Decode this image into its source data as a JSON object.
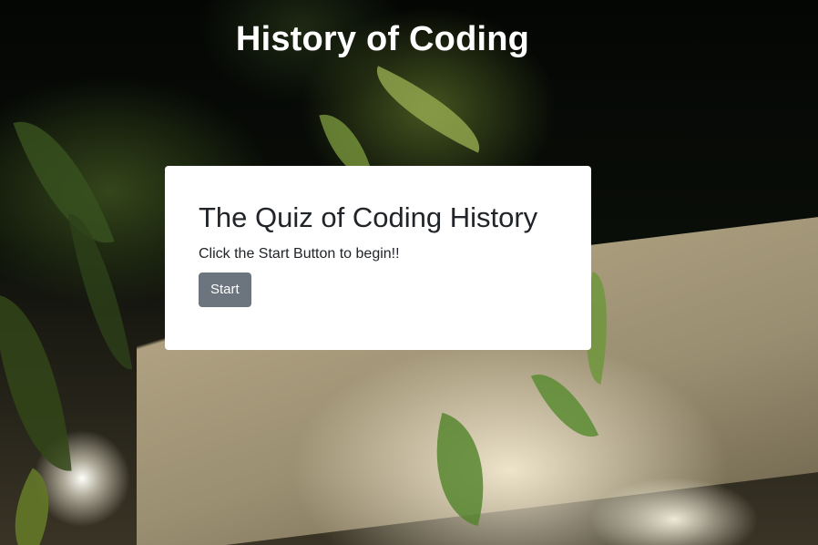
{
  "header": {
    "title": "History of Coding"
  },
  "quiz_card": {
    "title": "The Quiz of Coding History",
    "instruction": "Click the Start Button to begin!!",
    "start_label": "Start"
  },
  "colors": {
    "button_bg": "#6c757d",
    "card_bg": "#ffffff",
    "title_text": "#ffffff",
    "body_text": "#212529"
  }
}
